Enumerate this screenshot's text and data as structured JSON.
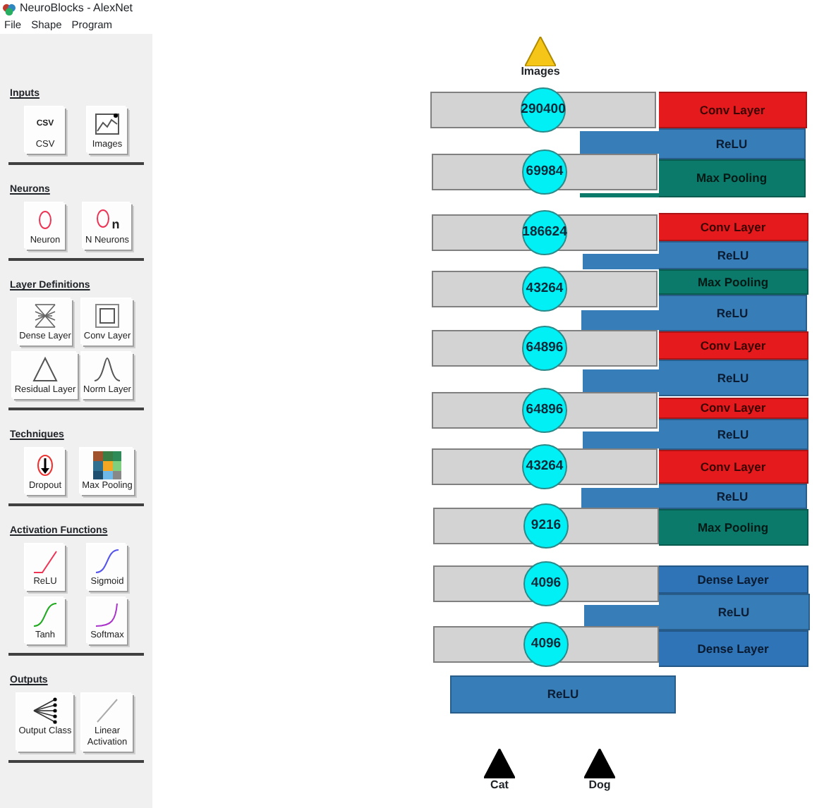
{
  "window": {
    "title": "NeuroBlocks - AlexNet"
  },
  "menu": [
    "File",
    "Shape",
    "Program"
  ],
  "palette": [
    {
      "title": "Inputs",
      "items": [
        {
          "kind": "csv",
          "glyph": "CSV",
          "label": "CSV"
        },
        {
          "kind": "images",
          "label": "Images"
        }
      ]
    },
    {
      "title": "Neurons",
      "items": [
        {
          "kind": "neuron",
          "label": "Neuron"
        },
        {
          "kind": "nneurons",
          "glyph": "n",
          "label": "N Neurons"
        }
      ]
    },
    {
      "title": "Layer Definitions",
      "items": [
        {
          "kind": "dense",
          "label": "Dense Layer"
        },
        {
          "kind": "conv",
          "label": "Conv Layer"
        },
        {
          "kind": "residual",
          "label": "Residual Layer"
        },
        {
          "kind": "norm",
          "label": "Norm Layer"
        }
      ]
    },
    {
      "title": "Techniques",
      "items": [
        {
          "kind": "dropout",
          "label": "Dropout"
        },
        {
          "kind": "maxpool",
          "label": "Max Pooling"
        }
      ]
    },
    {
      "title": "Activation Functions",
      "items": [
        {
          "kind": "relu",
          "label": "ReLU"
        },
        {
          "kind": "sigmoid",
          "label": "Sigmoid"
        },
        {
          "kind": "tanh",
          "label": "Tanh"
        },
        {
          "kind": "softmax",
          "label": "Softmax"
        }
      ]
    },
    {
      "title": "Outputs",
      "items": [
        {
          "kind": "output",
          "label": "Output Class"
        },
        {
          "kind": "linear",
          "label": "Linear Activation"
        }
      ]
    }
  ],
  "input_nodes": [
    {
      "label": "Images"
    }
  ],
  "blocks": [
    {
      "kind": "conv",
      "label": "Conv Layer"
    },
    {
      "kind": "relu",
      "label": "ReLU"
    },
    {
      "kind": "maxpool",
      "label": "Max Pooling"
    },
    {
      "kind": "conv",
      "label": "Conv Layer"
    },
    {
      "kind": "relu",
      "label": "ReLU"
    },
    {
      "kind": "maxpool",
      "label": "Max Pooling"
    },
    {
      "kind": "relu",
      "label": "ReLU"
    },
    {
      "kind": "conv",
      "label": "Conv Layer"
    },
    {
      "kind": "relu",
      "label": "ReLU"
    },
    {
      "kind": "conv",
      "label": "Conv Layer"
    },
    {
      "kind": "relu",
      "label": "ReLU"
    },
    {
      "kind": "conv",
      "label": "Conv Layer"
    },
    {
      "kind": "relu",
      "label": "ReLU"
    },
    {
      "kind": "maxpool",
      "label": "Max Pooling"
    },
    {
      "kind": "dense",
      "label": "Dense Layer"
    },
    {
      "kind": "relu",
      "label": "ReLU"
    },
    {
      "kind": "dense",
      "label": "Dense Layer"
    },
    {
      "kind": "relu",
      "label": "ReLU"
    }
  ],
  "tensors": [
    {
      "size": "290400"
    },
    {
      "size": "69984"
    },
    {
      "size": "186624"
    },
    {
      "size": "43264"
    },
    {
      "size": "64896"
    },
    {
      "size": "64896"
    },
    {
      "size": "43264"
    },
    {
      "size": "9216"
    },
    {
      "size": "4096"
    },
    {
      "size": "4096"
    }
  ],
  "output_nodes": [
    {
      "label": "Cat"
    },
    {
      "label": "Dog"
    }
  ]
}
